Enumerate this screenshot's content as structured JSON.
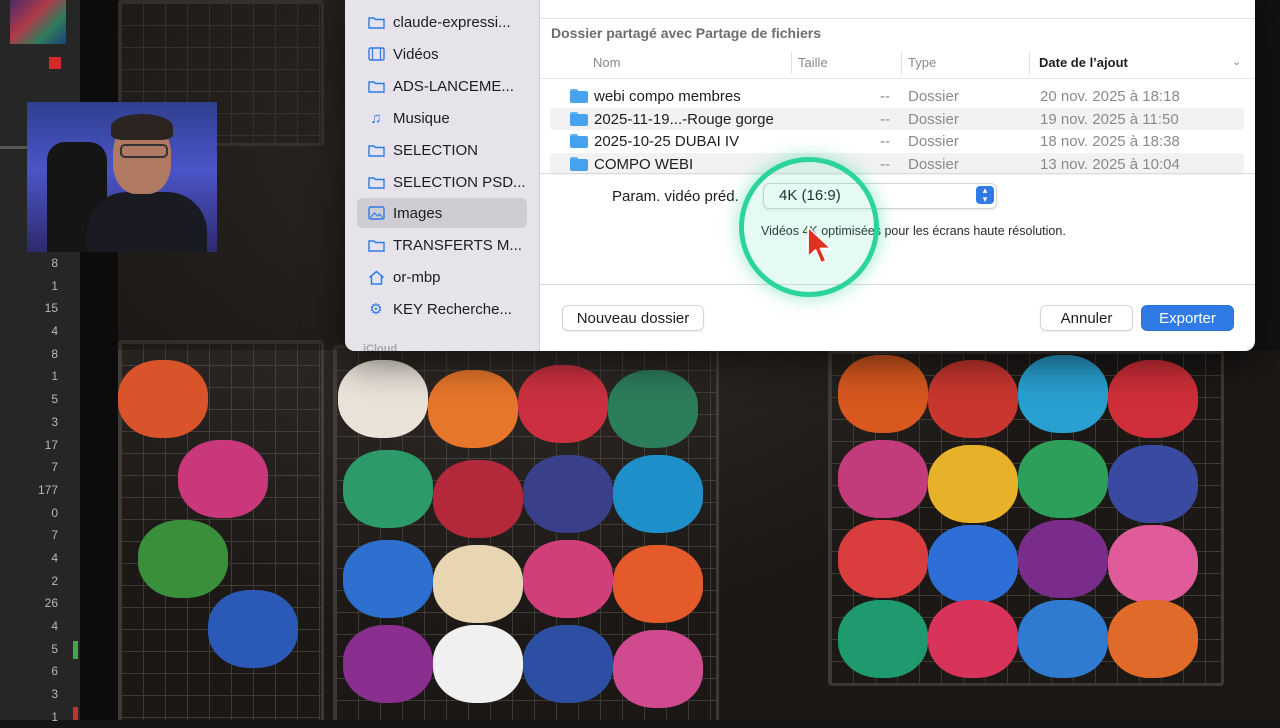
{
  "background_app": {
    "row_numbers": [
      "8",
      "1",
      "15",
      "4",
      "8",
      "1",
      "5",
      "3",
      "17",
      "7",
      "177",
      "0",
      "7",
      "4",
      "2",
      "26",
      "4",
      "5",
      "6",
      "3",
      "1"
    ]
  },
  "dialog": {
    "sidebar": {
      "items": [
        {
          "label": "claude-expressi...",
          "icon": "folder-icon"
        },
        {
          "label": "Vidéos",
          "icon": "film-icon"
        },
        {
          "label": "ADS-LANCEME...",
          "icon": "folder-icon"
        },
        {
          "label": "Musique",
          "icon": "music-note-icon"
        },
        {
          "label": "SELECTION",
          "icon": "folder-icon"
        },
        {
          "label": "SELECTION PSD...",
          "icon": "folder-icon"
        },
        {
          "label": "Images",
          "icon": "photo-icon",
          "selected": true
        },
        {
          "label": "TRANSFERTS M...",
          "icon": "folder-icon"
        },
        {
          "label": "or-mbp",
          "icon": "home-icon"
        },
        {
          "label": "KEY Recherche...",
          "icon": "gear-icon"
        }
      ],
      "section_icloud": "iCloud"
    },
    "location_title": "Dossier partagé avec Partage de fichiers",
    "columns": {
      "name": "Nom",
      "size": "Taille",
      "type": "Type",
      "date": "Date de l’ajout"
    },
    "files": [
      {
        "name": "webi compo membres",
        "size": "--",
        "type": "Dossier",
        "date": "20 nov. 2025 à 18:18"
      },
      {
        "name": "2025-11-19...-Rouge gorge",
        "size": "--",
        "type": "Dossier",
        "date": "19 nov. 2025 à 11:50"
      },
      {
        "name": "2025-10-25 DUBAI IV",
        "size": "--",
        "type": "Dossier",
        "date": "18 nov. 2025 à 18:38"
      },
      {
        "name": "COMPO WEBI",
        "size": "--",
        "type": "Dossier",
        "date": "13 nov. 2025 à 10:04"
      }
    ],
    "options": {
      "preset_label": "Param. vidéo préd.",
      "preset_value": "4K (16:9)",
      "preset_description": "Vidéos 4K optimisées pour les écrans haute résolution."
    },
    "buttons": {
      "new_folder": "Nouveau dossier",
      "cancel": "Annuler",
      "export": "Exporter"
    }
  },
  "colors": {
    "accent": "#2f7ae5",
    "click_highlight": "#2bd49a",
    "cursor": "#e0301e"
  }
}
